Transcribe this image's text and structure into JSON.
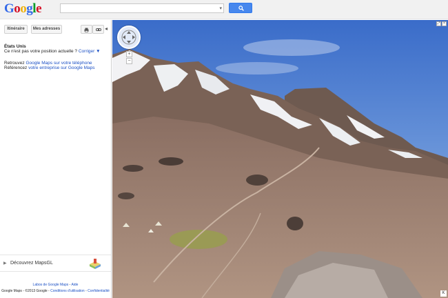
{
  "header": {
    "logo_letters": [
      {
        "ch": "G",
        "color": "#3369e8"
      },
      {
        "ch": "o",
        "color": "#d50f25"
      },
      {
        "ch": "o",
        "color": "#eeb211"
      },
      {
        "ch": "g",
        "color": "#3369e8"
      },
      {
        "ch": "l",
        "color": "#009925"
      },
      {
        "ch": "e",
        "color": "#d50f25"
      }
    ],
    "search_value": "",
    "search_icon": "search-icon"
  },
  "sidebar": {
    "itinerary_label": "Itinéraire",
    "my_places_label": "Mes adresses",
    "print_icon": "print-icon",
    "link_icon": "link-icon",
    "collapse_glyph": "◂",
    "location_title": "États Unis",
    "location_question": "Ce n'est pas votre position actuelle ?",
    "correct_link": "Corriger ▼",
    "promo1_prefix": "Retrouvez",
    "promo1_link": "Google Maps sur votre téléphone",
    "promo2_prefix": "Référencez",
    "promo2_link": "votre entreprise sur Google Maps",
    "mapsgl_label": "Découvrez MapsGL",
    "footer_labs": "Labos de Google Maps",
    "footer_sep": "-",
    "footer_help": "Aide",
    "footer_copy": "Google Maps - ©2013 Google -",
    "footer_terms": "Conditions d'utilisation",
    "footer_privacy": "Confidentialité"
  },
  "streetview": {
    "zoom_in": "+",
    "zoom_out": "−",
    "exit_glyph": "K",
    "colors": {
      "sky_top": "#3a6cc9",
      "sky_bottom": "#9cc0ea",
      "rock": "#6b5a52",
      "snow": "#f2f2f4",
      "ground": "#a88a78",
      "moss": "#9a9a55"
    }
  },
  "accent": {
    "link": "#1a4fc4",
    "search_button": "#4787ed"
  }
}
